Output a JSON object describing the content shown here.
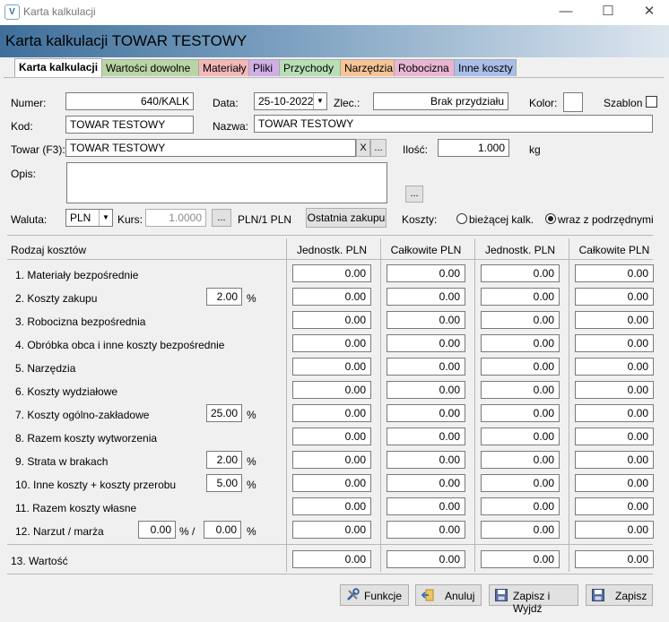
{
  "window": {
    "title": "Karta kalkulacji",
    "app_icon": "V",
    "minimize": "—",
    "maximize": "☐",
    "close": "✕"
  },
  "header": {
    "title": "Karta kalkulacji TOWAR TESTOWY"
  },
  "tabs": [
    {
      "label": "Karta kalkulacji",
      "color": "#ffffff"
    },
    {
      "label": "Wartości dowolne",
      "color": "#b9d5a6"
    },
    {
      "label": "Materiały",
      "color": "#f3b8b8"
    },
    {
      "label": "Pliki",
      "color": "#d0aee6"
    },
    {
      "label": "Przychody",
      "color": "#b7dfb4"
    },
    {
      "label": "Narzędzia",
      "color": "#f7c497"
    },
    {
      "label": "Robocizna",
      "color": "#e8b6d3"
    },
    {
      "label": "Inne koszty",
      "color": "#a9bee8"
    }
  ],
  "form": {
    "numer_label": "Numer:",
    "numer": "640/KALK",
    "data_label": "Data:",
    "data": "25-10-2022",
    "zlec_label": "Zlec.:",
    "zlec": "Brak przydziału",
    "kolor_label": "Kolor:",
    "szablon_label": "Szablon",
    "kod_label": "Kod:",
    "kod": "TOWAR TESTOWY",
    "nazwa_label": "Nazwa:",
    "nazwa": "TOWAR TESTOWY",
    "towar_label": "Towar (F3):",
    "towar": "TOWAR TESTOWY",
    "towar_clear": "X",
    "towar_browse": "...",
    "ilosc_label": "Ilość:",
    "ilosc": "1.000",
    "unit": "kg",
    "opis_label": "Opis:",
    "opis": "",
    "opis_browse": "...",
    "waluta_label": "Waluta:",
    "waluta": "PLN",
    "kurs_label": "Kurs:",
    "kurs": "1.0000",
    "kurs_browse": "...",
    "kurs_unit": "PLN/1 PLN",
    "ostatnia_button": "Ostatnia zakupu",
    "koszty_label": "Koszty:",
    "radio_biezacej": "bieżącej kalk.",
    "radio_wraz": "wraz z podrzędnymi",
    "radio_selected": "wraz z podrzędnymi"
  },
  "table": {
    "headers": [
      "Rodzaj kosztów",
      "Jednostk. PLN",
      "Całkowite PLN",
      "Jednostk. PLN",
      "Całkowite PLN"
    ],
    "rows": [
      {
        "label": "1. Materiały bezpośrednie",
        "values": [
          "0.00",
          "0.00",
          "0.00",
          "0.00"
        ]
      },
      {
        "label": "2. Koszty zakupu",
        "pct": "2.00",
        "pct_sign": "%",
        "values": [
          "0.00",
          "0.00",
          "0.00",
          "0.00"
        ]
      },
      {
        "label": "3. Robocizna bezpośrednia",
        "values": [
          "0.00",
          "0.00",
          "0.00",
          "0.00"
        ]
      },
      {
        "label": "4. Obróbka obca i inne koszty bezpośrednie",
        "values": [
          "0.00",
          "0.00",
          "0.00",
          "0.00"
        ]
      },
      {
        "label": "5. Narzędzia",
        "values": [
          "0.00",
          "0.00",
          "0.00",
          "0.00"
        ]
      },
      {
        "label": "6. Koszty wydziałowe",
        "values": [
          "0.00",
          "0.00",
          "0.00",
          "0.00"
        ]
      },
      {
        "label": "7. Koszty ogólno-zakładowe",
        "pct": "25.00",
        "pct_sign": "%",
        "values": [
          "0.00",
          "0.00",
          "0.00",
          "0.00"
        ]
      },
      {
        "label": "8. Razem koszty wytworzenia",
        "values": [
          "0.00",
          "0.00",
          "0.00",
          "0.00"
        ]
      },
      {
        "label": "9. Strata w brakach",
        "pct": "2.00",
        "pct_sign": "%",
        "values": [
          "0.00",
          "0.00",
          "0.00",
          "0.00"
        ]
      },
      {
        "label": "10. Inne koszty + koszty przerobu",
        "pct": "5.00",
        "pct_sign": "%",
        "values": [
          "0.00",
          "0.00",
          "0.00",
          "0.00"
        ]
      },
      {
        "label": "11. Razem koszty własne",
        "values": [
          "0.00",
          "0.00",
          "0.00",
          "0.00"
        ]
      },
      {
        "label": "12. Narzut / marża",
        "pct_a": "0.00",
        "pct_a_sign": "%",
        "slash": "/",
        "pct": "0.00",
        "pct_sign": "%",
        "values": [
          "0.00",
          "0.00",
          "0.00",
          "0.00"
        ]
      }
    ],
    "total": {
      "label": "13. Wartość",
      "values": [
        "0.00",
        "0.00",
        "0.00",
        "0.00"
      ]
    }
  },
  "buttons": {
    "funkcje": "Funkcje",
    "anuluj": "Anuluj",
    "zapisz_wyjdz": "Zapisz i Wyjdź",
    "zapisz": "Zapisz"
  }
}
